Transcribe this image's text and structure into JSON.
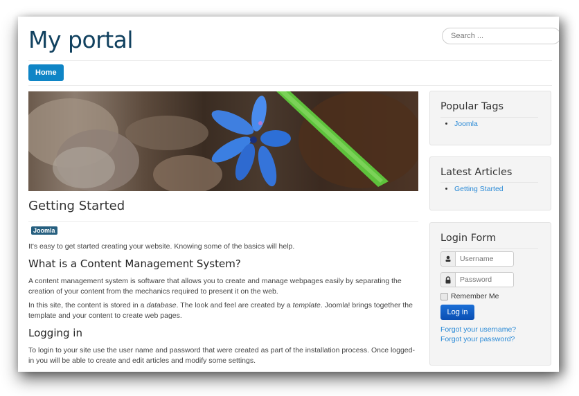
{
  "header": {
    "site_title": "My portal",
    "search_placeholder": "Search ..."
  },
  "nav": {
    "items": [
      {
        "label": "Home",
        "active": true
      }
    ]
  },
  "article": {
    "title": "Getting Started",
    "tag": "Joomla",
    "intro": "It's easy to get started creating your website. Knowing some of the basics will help.",
    "sections": [
      {
        "heading": "What is a Content Management System?",
        "paragraphs": [
          "A content management system is software that allows you to create and manage webpages easily by separating the creation of your content from the mechanics required to present it on the web.",
          "In this site, the content is stored in a database. The look and feel are created by a template. Joomla! brings together the template and your content to create web pages."
        ]
      },
      {
        "heading": "Logging in",
        "paragraphs": [
          "To login to your site use the user name and password that were created as part of the installation process. Once logged-in you will be able to create and edit articles and modify some settings."
        ]
      }
    ],
    "p2_parts": {
      "a": "In this site, the content is stored in a ",
      "em1": "database",
      "b": ". The look and feel are created by a ",
      "em2": "template",
      "c": ". Joomla! brings together the template and your content to create web pages."
    }
  },
  "sidebar": {
    "popular_tags": {
      "title": "Popular Tags",
      "items": [
        "Joomla"
      ]
    },
    "latest_articles": {
      "title": "Latest Articles",
      "items": [
        "Getting Started"
      ]
    },
    "login": {
      "title": "Login Form",
      "username_placeholder": "Username",
      "password_placeholder": "Password",
      "remember_label": "Remember Me",
      "remember_checked": false,
      "submit_label": "Log in",
      "forgot_username": "Forgot your username?",
      "forgot_password": "Forgot your password?"
    }
  },
  "colors": {
    "title": "#11415f",
    "nav_active": "#0f85c6",
    "tag": "#265f7f",
    "link": "#2a8ad6",
    "button": "#0b4fb3"
  }
}
